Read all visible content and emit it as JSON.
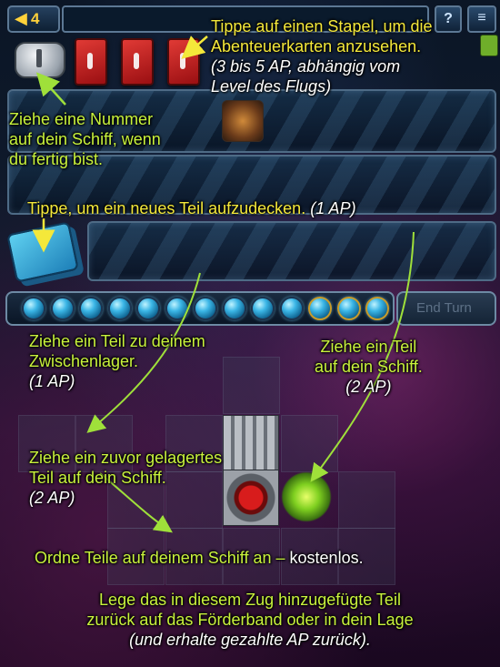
{
  "top_bar": {
    "level_number": "4"
  },
  "end_turn_label": "End Turn",
  "energy_orbs": {
    "total": 13,
    "gold_indices": [
      10,
      11,
      12
    ]
  },
  "annotations": {
    "stack": {
      "line1": "Tippe auf einen Stapel, um die",
      "line2": "Abenteuerkarten anzusehen.",
      "line3": "(3 bis 5 AP, abhängig vom",
      "line4": "Level des Flugs)"
    },
    "number": {
      "line1": "Ziehe eine Nummer",
      "line2": "auf dein Schiff, wenn",
      "line3": "du fertig bist."
    },
    "reveal": {
      "text": "Tippe, um ein neues Teil aufzudecken.",
      "cost": "(1 AP)"
    },
    "stash": {
      "line1": "Ziehe ein Teil zu deinem",
      "line2": "Zwischenlager.",
      "cost": "(1 AP)"
    },
    "to_ship": {
      "line1": "Ziehe ein Teil",
      "line2": "auf dein Schiff.",
      "cost": "(2 AP)"
    },
    "from_stash": {
      "line1": "Ziehe ein zuvor gelagertes",
      "line2": "Teil auf dein Schiff.",
      "cost": "(2 AP)"
    },
    "arrange": {
      "text": "Ordne Teile auf deinem Schiff an –",
      "free": "kostenlos."
    },
    "return": {
      "line1": "Lege das in diesem Zug hinzugefügte Teil",
      "line2": "zurück auf das Förderband oder in dein Lage",
      "line3": "(und erhalte gezahlte AP zurück)."
    }
  },
  "colors": {
    "highlight_text": "#c8f23c",
    "stack_text": "#f4e83a",
    "card_red": "#d62a2a",
    "arrow": "#9fe03a"
  }
}
